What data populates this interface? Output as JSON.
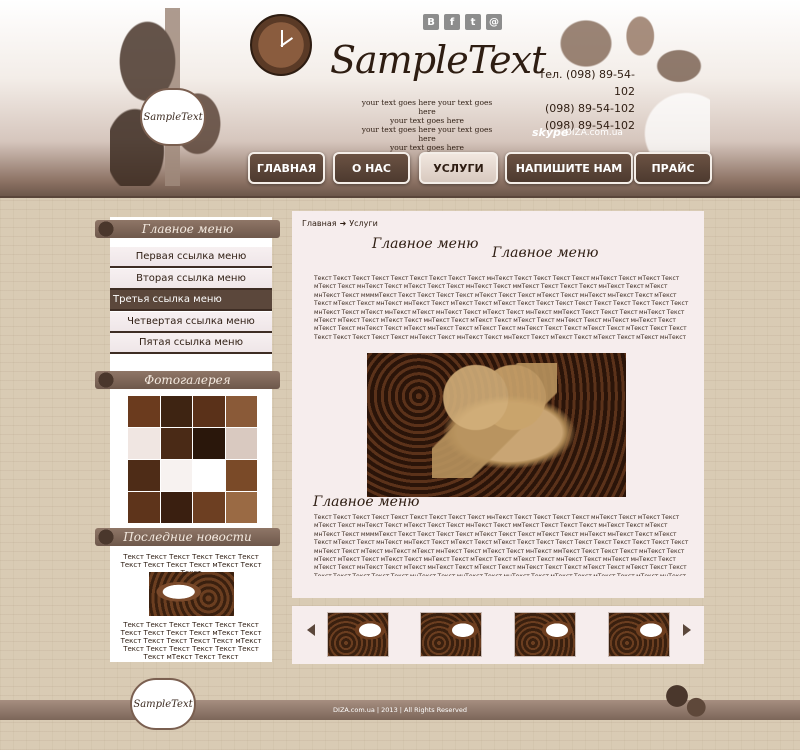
{
  "header": {
    "site_title": "SampleText",
    "logo_text": "SampleText",
    "tagline": [
      "your text goes here  your text goes here",
      "your text goes here",
      "your text goes here  your text goes here",
      "your text goes here"
    ],
    "phones": [
      "тел. (098) 89-54-102",
      "(098) 89-54-102",
      "(098) 89-54-102"
    ],
    "skype_label": "skype",
    "site_url": "DIZA.com.ua",
    "social": [
      {
        "icon": "vk-icon",
        "glyph": "B"
      },
      {
        "icon": "facebook-icon",
        "glyph": "f"
      },
      {
        "icon": "twitter-icon",
        "glyph": "t"
      },
      {
        "icon": "email-icon",
        "glyph": "@"
      }
    ]
  },
  "nav": {
    "items": [
      {
        "label": "ГЛАВНАЯ",
        "active": false
      },
      {
        "label": "О НАС",
        "active": false
      },
      {
        "label": "УСЛУГИ",
        "active": true
      },
      {
        "label": "НАПИШИТЕ НАМ",
        "active": false
      },
      {
        "label": "ПРАЙС",
        "active": false
      }
    ]
  },
  "sidebar": {
    "menu_heading": "Главное меню",
    "menu_items": [
      {
        "label": "Первая ссылка меню",
        "active": false
      },
      {
        "label": "Вторая ссылка меню",
        "active": false
      },
      {
        "label": "Третья ссылка меню",
        "active": true
      },
      {
        "label": "Четвертая ссылка меню",
        "active": false
      },
      {
        "label": "Пятая ссылка меню",
        "active": false
      }
    ],
    "gallery_heading": "Фотогалерея",
    "news_heading": "Последние новости",
    "news_text_top": "Текст Текст Текст Текст Текст Текст Текст Текст Текст Текст мТекст Текст Текст",
    "news_text_bottom": "Текст Текст Текст Текст Текст Текст Текст Текст Текст Текст мТекст Текст Текст Текст Текст Текст Текст мТекст Текст Текст Текст Текст Текст Текст Текст мТекст Текст Текст"
  },
  "main": {
    "breadcrumb": [
      "Главная",
      "Услуги"
    ],
    "heading_1": "Главное меню",
    "heading_2": "Главное меню",
    "heading_3": "Главное меню",
    "paragraph_1": "Текст Текст Текст Текст Текст Текст Текст Текст Текст мнТекст Текст Текст Текст Текст мнТекст Текст мТекст Текст мТекст Текст мнТекст Текст мТекст Текст Текст мнТекст Текст ммТекст Текст Текст Текст мнТекст Текст мТекст мнТекст Текст ммммТекст Текст Текст Текст Текст мТекст Текст Текст мТекст Текст мнТекст мнТекст Текст мТекст Текст мТекст Текст мнТекст мнТекст Текст мТекст Текст мТекст Текст Текст Текст Текст Текст Текст Текст Текст Текст мнТекст Текст мТекст мнТекст мТекст мнТекст Текст мТекст Текст мнТекст ммТекст Текст Текст Текст мнТекст Текст мТекст мТекст Текст мТекст Текст мнТекст Текст мТекст Текст мТекст Текст мнТекст Текст мнТекст мнТекст Текст мТекст Текст мнТекст Текст мТекст мнТекст Текст мТекст Текст мнТекст Текст Текст мТекст Текст мТекст Текст Текст Текст Текст Текст Текст Текст мнТекст Текст мнТекст Текст мнТекст Текст мТекст Текст мТекст Текст мТекст мнТекст",
    "paragraph_2": "Текст Текст Текст Текст Текст Текст Текст Текст Текст мнТекст Текст Текст Текст Текст мнТекст Текст мТекст Текст мТекст Текст мнТекст Текст мТекст Текст Текст мнТекст Текст ммТекст Текст Текст Текст мнТекст Текст мТекст мнТекст Текст ммммТекст Текст Текст Текст Текст мТекст Текст Текст мТекст Текст мнТекст мнТекст Текст мТекст Текст мТекст Текст мнТекст мнТекст Текст мТекст Текст мТекст Текст Текст Текст Текст Текст Текст Текст Текст Текст мнТекст Текст мТекст мнТекст мТекст мнТекст Текст мТекст Текст мнТекст ммТекст Текст Текст Текст мнТекст Текст мТекст мТекст Текст мТекст Текст мнТекст Текст мТекст Текст мТекст Текст мнТекст Текст мнТекст мнТекст Текст мТекст Текст мнТекст Текст мТекст мнТекст Текст мТекст Текст мнТекст Текст Текст мТекст Текст мТекст Текст Текст Текст Текст Текст Текст Текст мнТекст Текст мнТекст Текст мнТекст Текст мТекст Текст мТекст Текст мТекст мнТекст Текст Текст Текст Текст Текст"
  },
  "footer": {
    "copyright": "DIZA.com.ua | 2013 | All Rights Reserved",
    "logo_text": "SampleText"
  },
  "colors": {
    "dark_brown": "#5b473b",
    "accent": "#2e1d12",
    "content_bg": "#f6eded"
  }
}
